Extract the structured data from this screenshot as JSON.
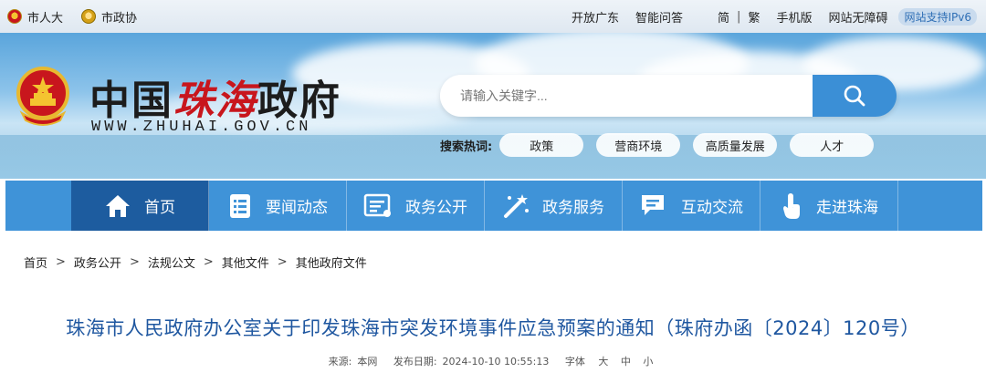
{
  "topbar": {
    "left_links": [
      {
        "label": "市人大",
        "icon": "emblem-icon"
      },
      {
        "label": "市政协",
        "icon": "cppcc-emblem-icon"
      }
    ],
    "right_links": [
      "开放广东",
      "智能问答"
    ],
    "lang_simplified": "简",
    "lang_separator": "|",
    "lang_traditional": "繁",
    "mobile": "手机版",
    "accessibility": "网站无障碍",
    "ipv6": "网站支持IPv6"
  },
  "header": {
    "logo_prefix": "中国",
    "logo_highlight": "珠海",
    "logo_suffix": "政府",
    "logo_url_text": "WWW.ZHUHAI.GOV.CN",
    "search_placeholder": "请输入关键字...",
    "hot_label": "搜索热词:",
    "hot_words": [
      "政策",
      "营商环境",
      "高质量发展",
      "人才"
    ]
  },
  "nav": {
    "items": [
      {
        "label": "首页",
        "icon": "home-icon"
      },
      {
        "label": "要闻动态",
        "icon": "news-list-icon"
      },
      {
        "label": "政务公开",
        "icon": "document-list-icon"
      },
      {
        "label": "政务服务",
        "icon": "magic-wand-icon"
      },
      {
        "label": "互动交流",
        "icon": "chat-bubble-icon"
      },
      {
        "label": "走进珠海",
        "icon": "pointer-hand-icon"
      }
    ],
    "active_index": 0
  },
  "breadcrumb": [
    "首页",
    "政务公开",
    "法规公文",
    "其他文件",
    "其他政府文件"
  ],
  "breadcrumb_separator": ">",
  "article": {
    "title": "珠海市人民政府办公室关于印发珠海市突发环境事件应急预案的通知（珠府办函〔2024〕120号）",
    "source_label": "来源:",
    "source": "本网",
    "date_label": "发布日期:",
    "date": "2024-10-10 10:55:13",
    "font_label": "字体",
    "font_sizes": [
      "大",
      "中",
      "小"
    ]
  },
  "colors": {
    "nav_bg": "#3f93d8",
    "nav_active": "#1d5c9f",
    "title_blue": "#1f57a0",
    "accent_red": "#c8161d"
  }
}
